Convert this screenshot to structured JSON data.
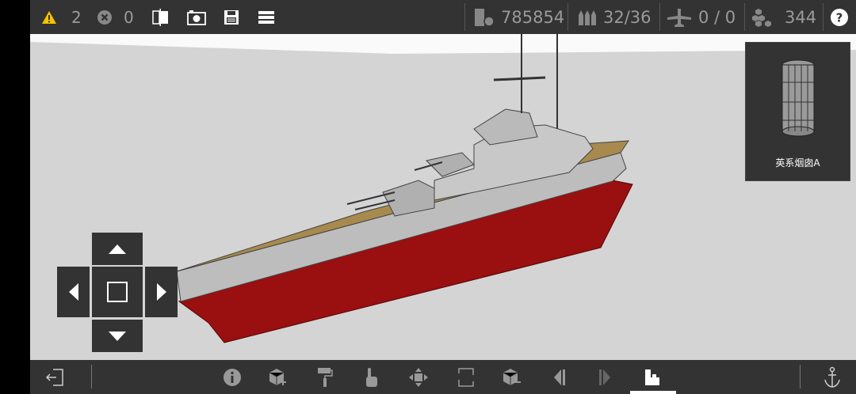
{
  "topbar": {
    "warnings": "2",
    "errors": "0",
    "money": "785854",
    "ammo": "32/36",
    "aircraft": "0 / 0",
    "parts": "344",
    "icons": [
      "warning-icon",
      "error-icon",
      "mirror-icon",
      "camera-icon",
      "save-icon",
      "menu-icon",
      "coins-icon",
      "shells-icon",
      "plane-icon",
      "blocks-icon",
      "help-icon"
    ]
  },
  "preview": {
    "label": "英系烟囱A"
  },
  "dpad": {
    "icons": [
      "arrow-up-icon",
      "arrow-left-icon",
      "center-square-icon",
      "arrow-right-icon",
      "arrow-down-icon"
    ]
  },
  "bottombar": {
    "icons": [
      "exit-icon",
      "info-icon",
      "add-block-icon",
      "paint-roller-icon",
      "hand-pointer-icon",
      "move-icon",
      "rotate-icon",
      "remove-block-icon",
      "previous-icon",
      "next-icon",
      "build-mode-icon",
      "anchor-icon"
    ],
    "active": "build-mode-icon"
  },
  "colors": {
    "bar": "#333333",
    "viewport": "#d4d4d4",
    "hull_red": "#9a0f0f",
    "deck": "#a88a4e",
    "hull_gray": "#bdbdbd",
    "warning": "#f5c400"
  }
}
